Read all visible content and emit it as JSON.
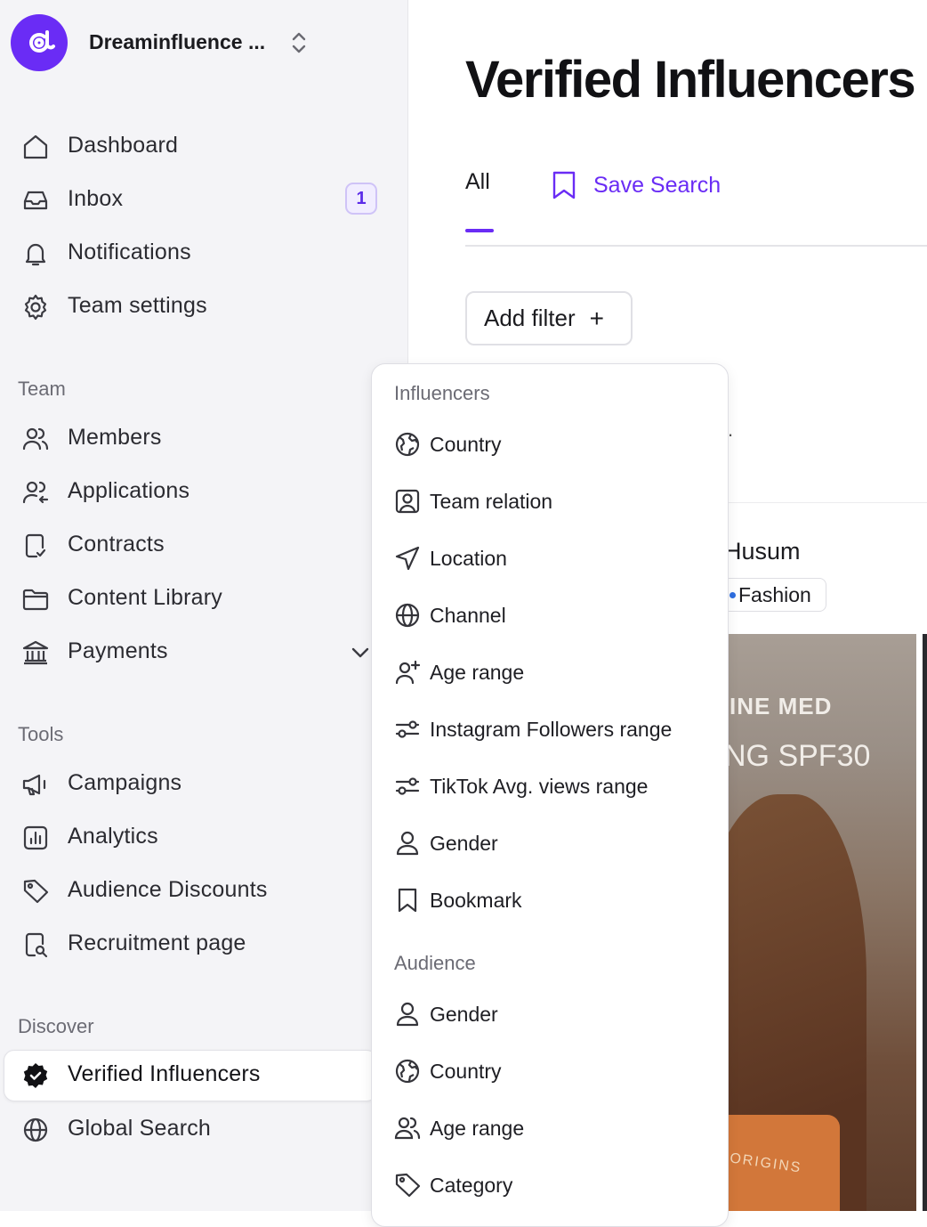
{
  "workspace": {
    "name": "Dreaminfluence ...",
    "logo": "at-sign-logo"
  },
  "nav": {
    "dashboard": "Dashboard",
    "inbox": "Inbox",
    "inbox_badge": "1",
    "notifications": "Notifications",
    "team_settings": "Team settings"
  },
  "sections": {
    "team": "Team",
    "tools": "Tools",
    "discover": "Discover"
  },
  "team_nav": {
    "members": "Members",
    "applications": "Applications",
    "contracts": "Contracts",
    "content_library": "Content Library",
    "payments": "Payments"
  },
  "tools_nav": {
    "campaigns": "Campaigns",
    "analytics": "Analytics",
    "audience_discounts": "Audience Discounts",
    "recruitment_page": "Recruitment page"
  },
  "discover_nav": {
    "verified_influencers": "Verified Influencers",
    "global_search": "Global Search"
  },
  "main": {
    "title": "Verified Influencers",
    "tab_all": "All",
    "save_search": "Save Search",
    "add_filter": "Add filter",
    "add_filter_icon": "+",
    "card": {
      "name": "Husum",
      "tag": "Fashion",
      "photo_text_1": "INE MED",
      "photo_text_2": "NG SPF30",
      "photo_text_3": "ORIGINS"
    }
  },
  "filter_menu": {
    "influencers_header": "Influencers",
    "influencers": [
      {
        "label": "Country",
        "icon": "globe-map-icon"
      },
      {
        "label": "Team relation",
        "icon": "user-square-icon"
      },
      {
        "label": "Location",
        "icon": "navigation-arrow-icon"
      },
      {
        "label": "Channel",
        "icon": "globe-icon"
      },
      {
        "label": "Age range",
        "icon": "user-plus-icon"
      },
      {
        "label": "Instagram Followers range",
        "icon": "slider-icon"
      },
      {
        "label": "TikTok Avg. views range",
        "icon": "slider-icon"
      },
      {
        "label": "Gender",
        "icon": "user-icon"
      },
      {
        "label": "Bookmark",
        "icon": "bookmark-icon"
      }
    ],
    "audience_header": "Audience",
    "audience": [
      {
        "label": "Gender",
        "icon": "user-icon"
      },
      {
        "label": "Country",
        "icon": "globe-map-icon"
      },
      {
        "label": "Age range",
        "icon": "users-icon"
      },
      {
        "label": "Category",
        "icon": "tag-icon"
      }
    ]
  },
  "colors": {
    "accent": "#6a2cf5",
    "sidebar_bg": "#f4f4f7",
    "badge_bg": "#f1edff"
  }
}
